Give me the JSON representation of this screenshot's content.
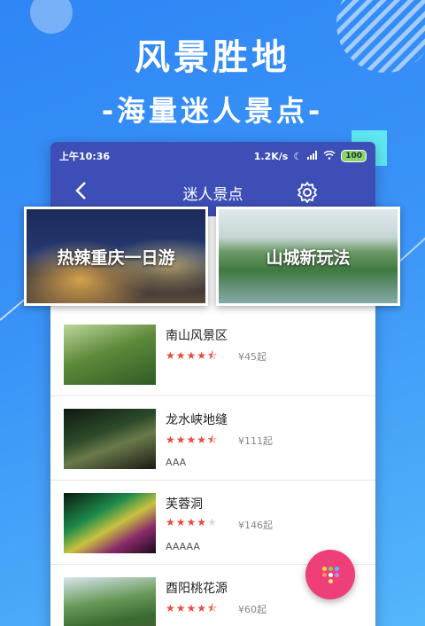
{
  "hero": {
    "title": "风景胜地",
    "subtitle": "-海量迷人景点-"
  },
  "status_bar": {
    "time": "上午10:36",
    "speed": "1.2K/s",
    "battery": "100",
    "icons": [
      "moon-icon",
      "signal-icon",
      "wifi-icon",
      "battery-icon"
    ]
  },
  "header": {
    "title": "迷人景点",
    "back_icon": "back-chevron-icon",
    "settings_icon": "gear-icon",
    "color": "#3d4fb6"
  },
  "banners": [
    {
      "label": "热辣重庆一日游"
    },
    {
      "label": "山城新玩法"
    }
  ],
  "list": {
    "items": [
      {
        "name": "南山风景区",
        "rating": 4.5,
        "price": "¥45起",
        "level": ""
      },
      {
        "name": "龙水峡地缝",
        "rating": 4.5,
        "price": "¥111起",
        "level": "AAA"
      },
      {
        "name": "芙蓉洞",
        "rating": 4,
        "price": "¥146起",
        "level": "AAAAA"
      },
      {
        "name": "酉阳桃花源",
        "rating": 4.5,
        "price": "¥60起",
        "level": ""
      }
    ]
  },
  "colors": {
    "background": "#3a93f7",
    "star": "#e84a3c",
    "fab": "#ee3f79"
  },
  "fab": {
    "icon": "grid-icon"
  }
}
